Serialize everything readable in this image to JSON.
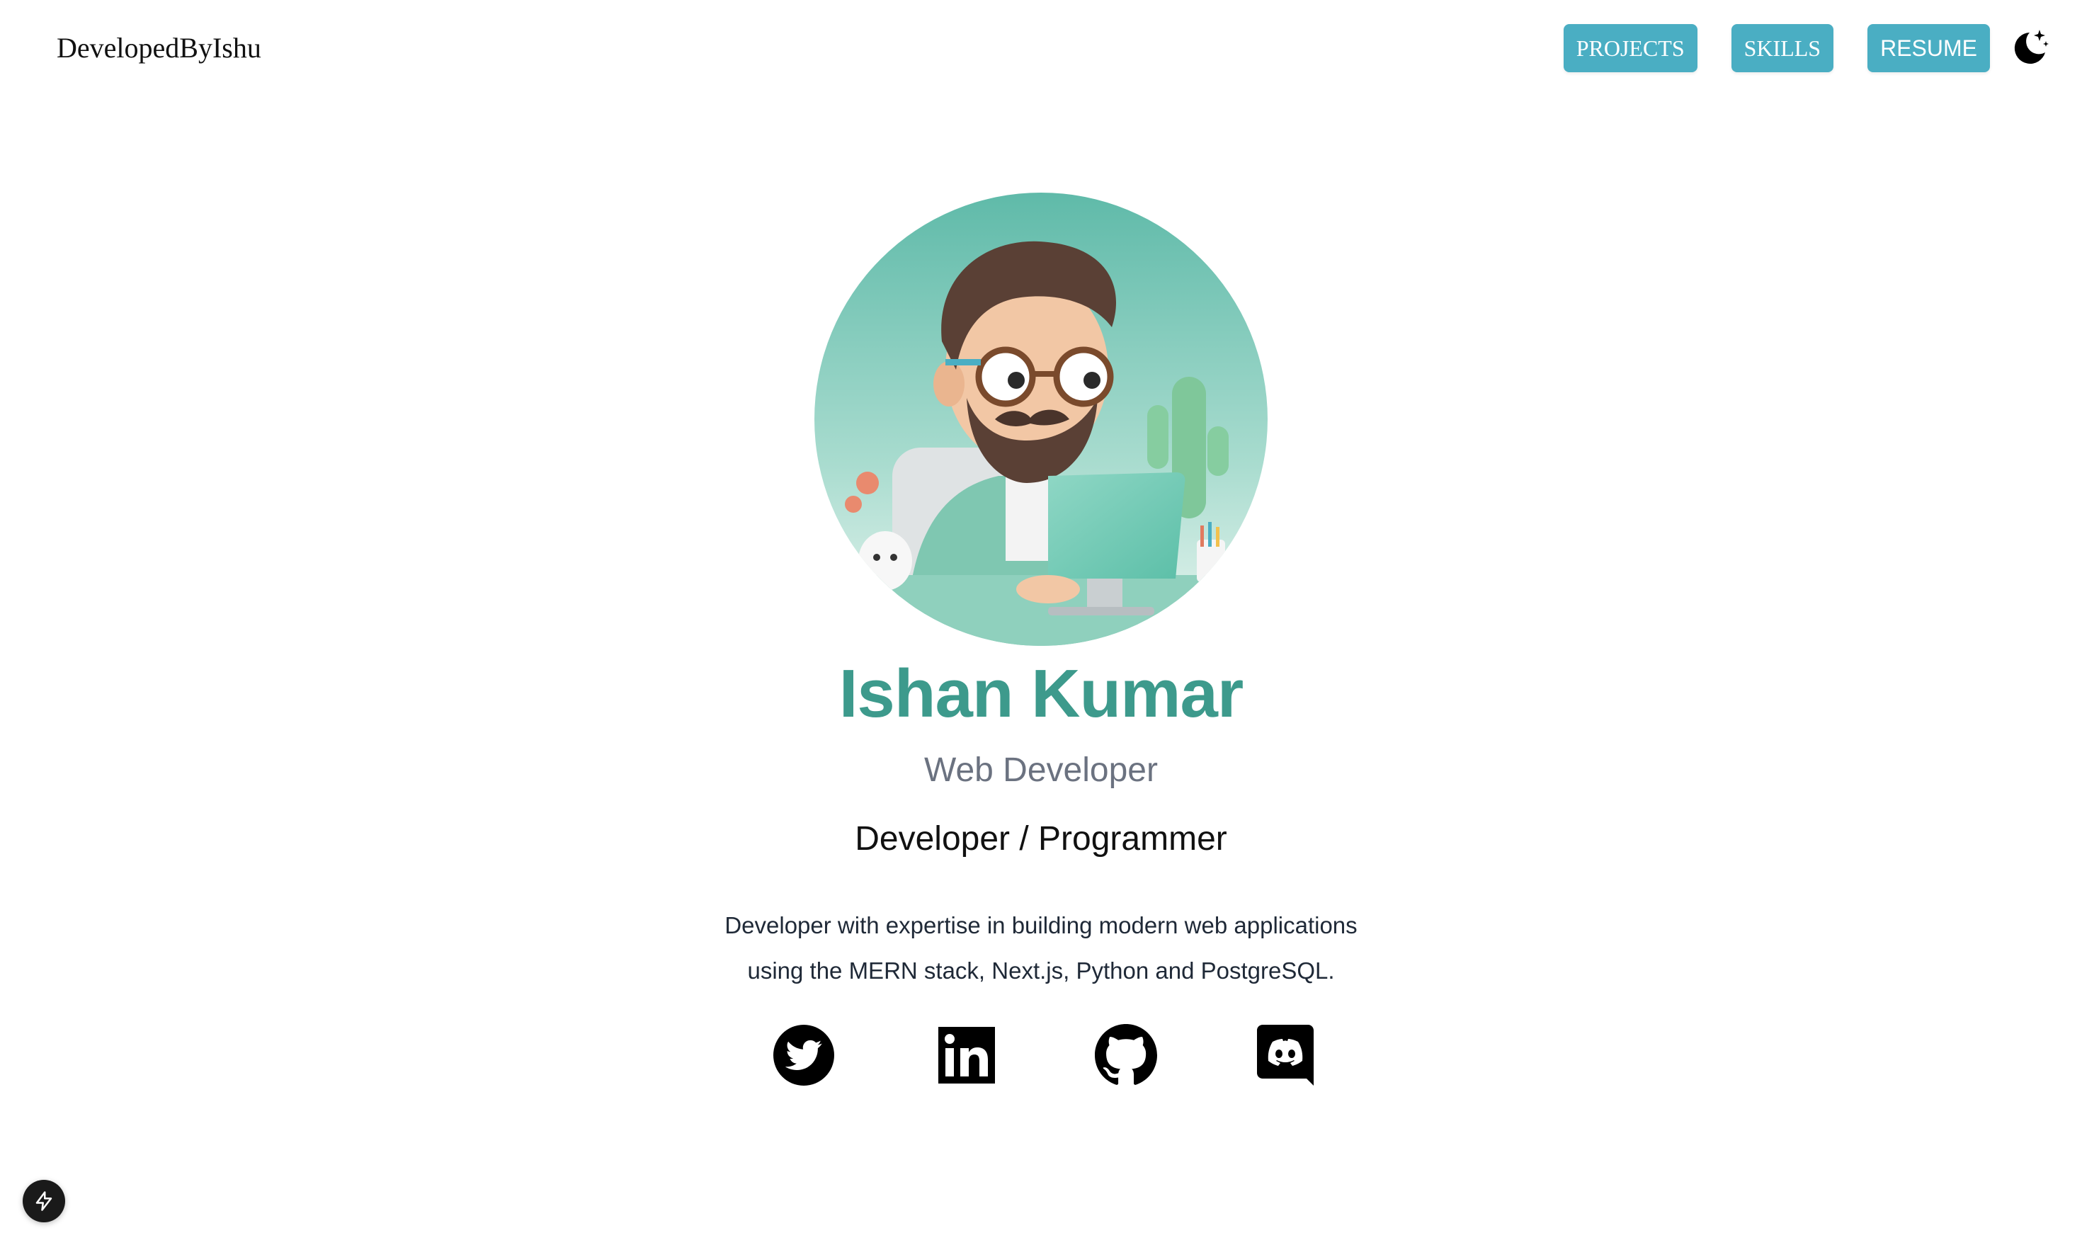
{
  "header": {
    "logo_text": "DevelopedByIshu",
    "nav": [
      {
        "label": "PROJECTS"
      },
      {
        "label": "SKILLS"
      },
      {
        "label": "RESUME"
      }
    ],
    "theme_toggle_icon": "moon-stars-icon"
  },
  "hero": {
    "avatar_icon": "developer-avatar-illustration",
    "name": "Ishan Kumar",
    "role": "Web Developer",
    "tagline": "Developer / Programmer",
    "description_lines": [
      "Developer with expertise in building modern web applications",
      "using the MERN stack, Next.js, Python and PostgreSQL."
    ]
  },
  "socials": [
    {
      "icon": "twitter-icon"
    },
    {
      "icon": "linkedin-icon"
    },
    {
      "icon": "github-icon"
    },
    {
      "icon": "discord-icon"
    }
  ],
  "fab_icon": "lightning-bolt-icon",
  "colors": {
    "accent": "#3d9a8c",
    "nav_button": "#4aaec3",
    "muted_text": "#6b7280"
  }
}
